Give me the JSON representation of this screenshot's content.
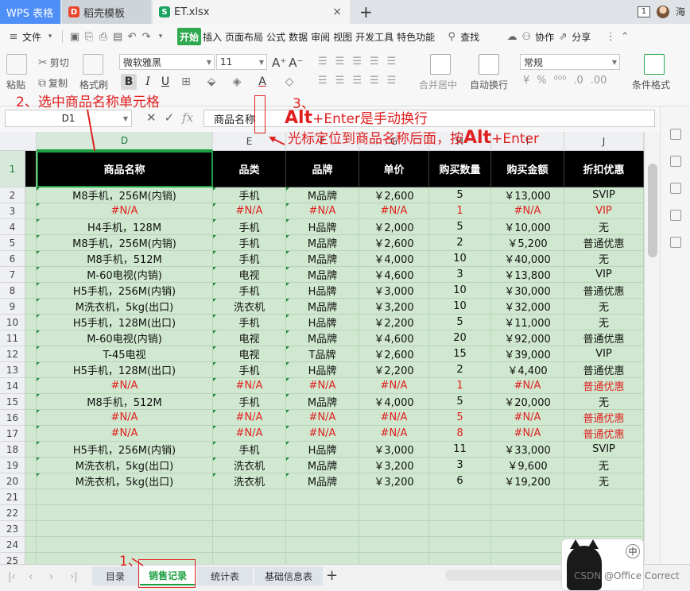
{
  "app_tabs": {
    "wps": "WPS 表格",
    "template": "稻壳模板",
    "doc": "ET.xlsx",
    "doc_badge": "S",
    "template_badge": "D",
    "close": "×",
    "new_tab": "+"
  },
  "window": {
    "badge": "1",
    "user": "海"
  },
  "menu": {
    "file": "文件",
    "items": [
      "开始",
      "插入",
      "页面布局",
      "公式",
      "数据",
      "审阅",
      "视图",
      "开发工具",
      "特色功能"
    ],
    "search": "查找",
    "collab": "协作",
    "share": "分享"
  },
  "ribbon": {
    "paste": "粘贴",
    "cut": "剪切",
    "copy": "复制",
    "format_painter": "格式刷",
    "font_name": "微软雅黑",
    "font_size": "11",
    "bold": "B",
    "italic": "I",
    "underline": "U",
    "merge_center": "合并居中",
    "wrap_text": "自动换行",
    "number_format": "常规",
    "conditional_format": "条件格式"
  },
  "formula_bar": {
    "name_box": "D1",
    "fx": "fx",
    "content": "商品名称"
  },
  "columns": [
    "D",
    "E",
    "F",
    "G",
    "H",
    "I",
    "J"
  ],
  "headers": [
    "商品名称",
    "品类",
    "品牌",
    "单价",
    "购买数量",
    "购买金额",
    "折扣优惠"
  ],
  "rows": [
    [
      "M8手机，256M(内销)",
      "手机",
      "M品牌",
      "￥2,600",
      "5",
      "￥13,000",
      "SVIP"
    ],
    [
      "#N/A",
      "#N/A",
      "#N/A",
      "#N/A",
      "1",
      "#N/A",
      "VIP"
    ],
    [
      "H4手机，128M",
      "手机",
      "H品牌",
      "￥2,000",
      "5",
      "￥10,000",
      "无"
    ],
    [
      "M8手机，256M(内销)",
      "手机",
      "M品牌",
      "￥2,600",
      "2",
      "￥5,200",
      "普通优惠"
    ],
    [
      "M8手机，512M",
      "手机",
      "M品牌",
      "￥4,000",
      "10",
      "￥40,000",
      "无"
    ],
    [
      "M-60电视(内销)",
      "电视",
      "M品牌",
      "￥4,600",
      "3",
      "￥13,800",
      "VIP"
    ],
    [
      "H5手机，256M(内销)",
      "手机",
      "H品牌",
      "￥3,000",
      "10",
      "￥30,000",
      "普通优惠"
    ],
    [
      "M洗衣机，5kg(出口)",
      "洗衣机",
      "M品牌",
      "￥3,200",
      "10",
      "￥32,000",
      "无"
    ],
    [
      "H5手机，128M(出口)",
      "手机",
      "H品牌",
      "￥2,200",
      "5",
      "￥11,000",
      "无"
    ],
    [
      "M-60电视(内销)",
      "电视",
      "M品牌",
      "￥4,600",
      "20",
      "￥92,000",
      "普通优惠"
    ],
    [
      "T-45电视",
      "电视",
      "T品牌",
      "￥2,600",
      "15",
      "￥39,000",
      "VIP"
    ],
    [
      "H5手机，128M(出口)",
      "手机",
      "H品牌",
      "￥2,200",
      "2",
      "￥4,400",
      "普通优惠"
    ],
    [
      "#N/A",
      "#N/A",
      "#N/A",
      "#N/A",
      "1",
      "#N/A",
      "普通优惠"
    ],
    [
      "M8手机，512M",
      "手机",
      "M品牌",
      "￥4,000",
      "5",
      "￥20,000",
      "无"
    ],
    [
      "#N/A",
      "#N/A",
      "#N/A",
      "#N/A",
      "5",
      "#N/A",
      "普通优惠"
    ],
    [
      "#N/A",
      "#N/A",
      "#N/A",
      "#N/A",
      "8",
      "#N/A",
      "普通优惠"
    ],
    [
      "H5手机，256M(内销)",
      "手机",
      "H品牌",
      "￥3,000",
      "11",
      "￥33,000",
      "SVIP"
    ],
    [
      "M洗衣机，5kg(出口)",
      "洗衣机",
      "M品牌",
      "￥3,200",
      "3",
      "￥9,600",
      "无"
    ],
    [
      "M洗衣机，5kg(出口)",
      "洗衣机",
      "M品牌",
      "￥3,200",
      "6",
      "￥19,200",
      "无"
    ]
  ],
  "error_rows": [
    3,
    14,
    16,
    17
  ],
  "row_numbers": [
    "1",
    "2",
    "3",
    "4",
    "5",
    "6",
    "7",
    "8",
    "9",
    "10",
    "11",
    "12",
    "13",
    "14",
    "15",
    "16",
    "17",
    "18",
    "19",
    "20",
    "21",
    "22",
    "23",
    "24",
    "25"
  ],
  "sheets": [
    "目录",
    "销售记录",
    "统计表",
    "基础信息表"
  ],
  "active_sheet": "销售记录",
  "add_sheet": "+",
  "annotations": {
    "step1": "1、",
    "step2": "2、选中商品名称单元格",
    "step3_num": "3、",
    "step3_alt": "Alt",
    "step3_line1_rest": "+Enter是手动换行",
    "step3_line2_pre": "光标定位到商品名称后面，按",
    "step3_line2_alt": "Alt",
    "step3_line2_rest": "+Enter"
  },
  "sticker": {
    "zh": "中"
  },
  "watermark": "CSDN @Office Correct",
  "colors": {
    "accent_green": "#1f9f43",
    "cell_fill": "#cfe8cf",
    "header_fill": "#000000",
    "error_red": "#e02020",
    "wps_blue": "#4e8ef7"
  }
}
